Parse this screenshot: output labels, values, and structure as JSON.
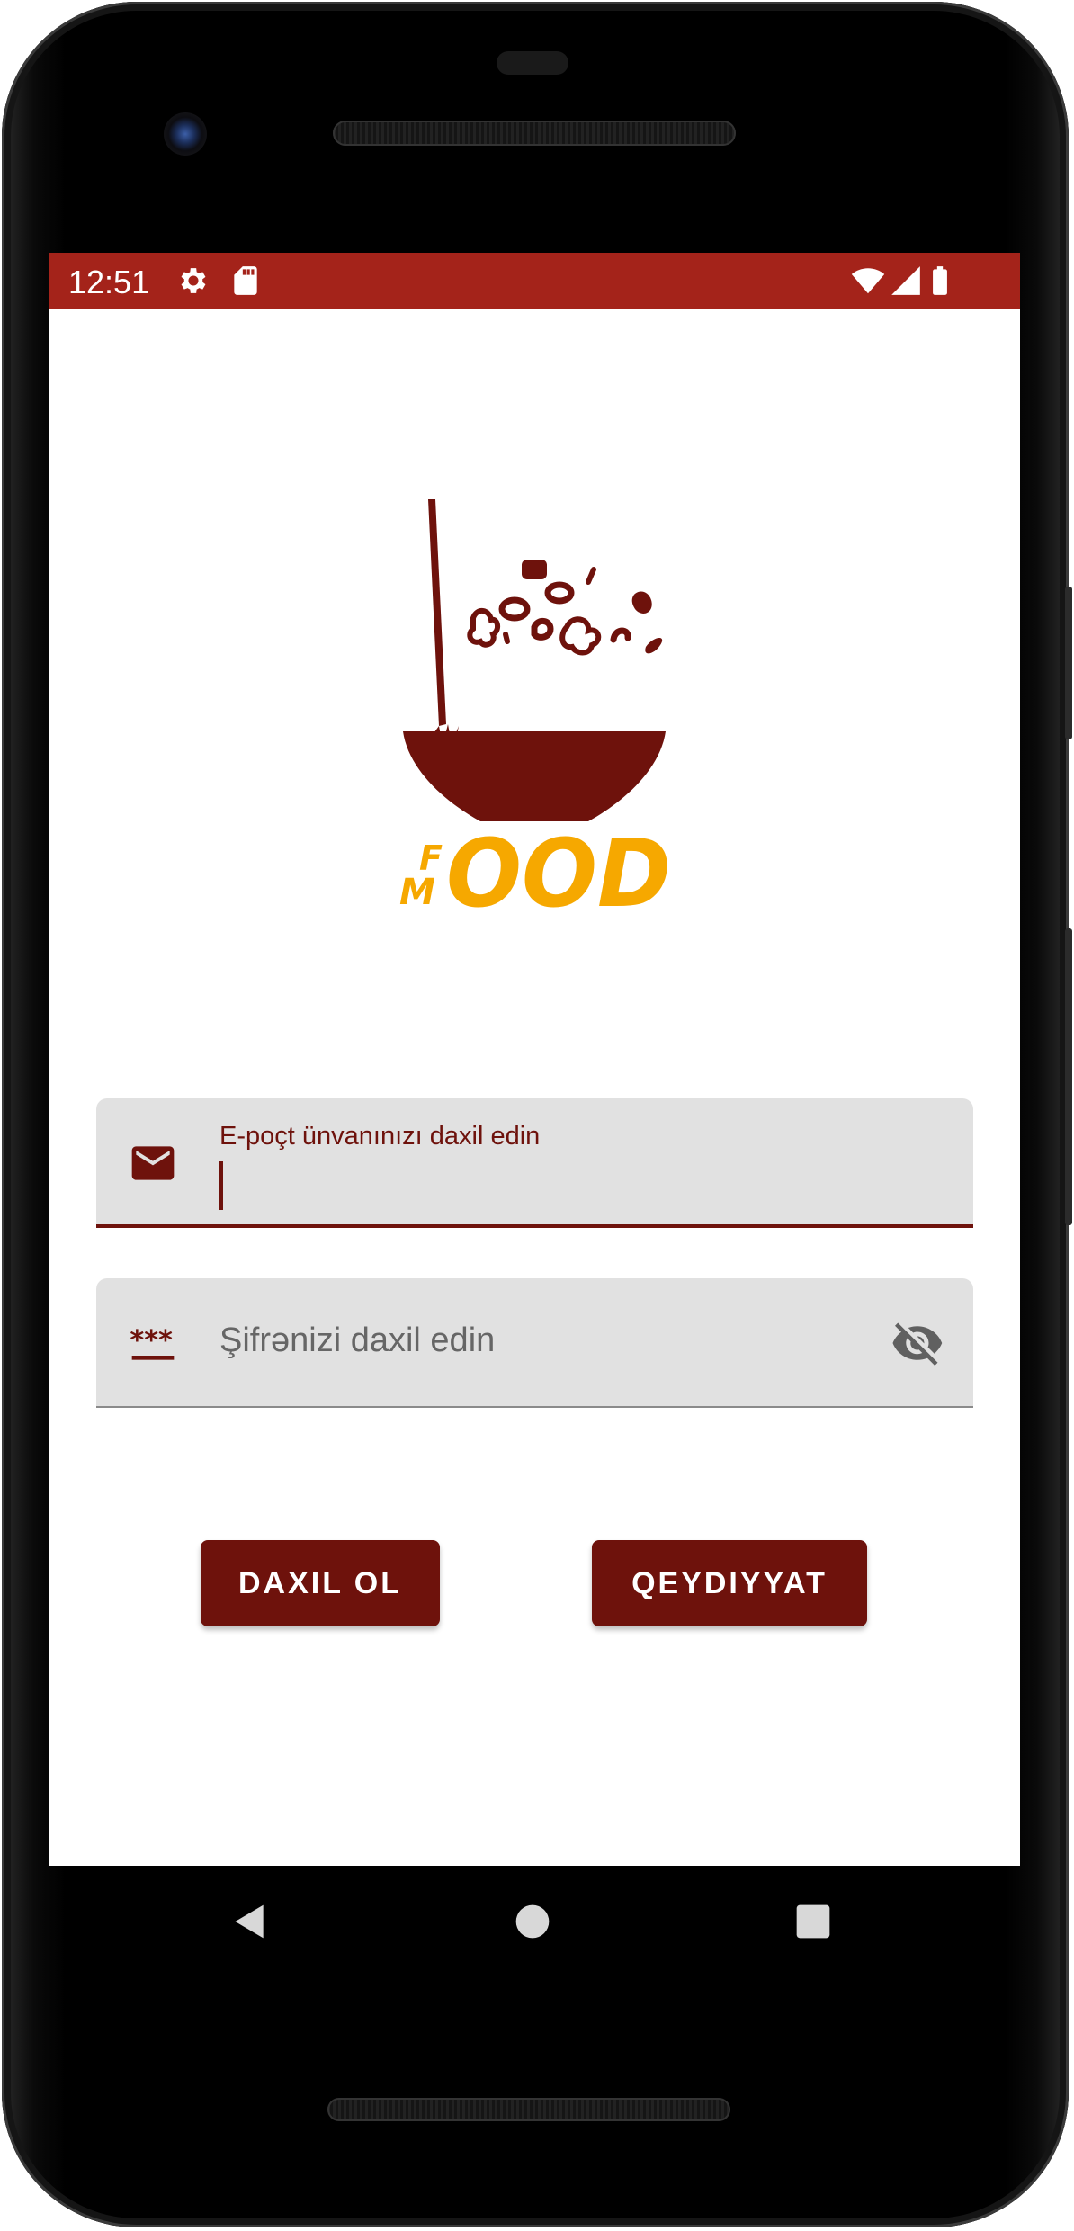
{
  "status_bar": {
    "time": "12:51",
    "background_color": "#a4231a",
    "left_icons": [
      "gear-icon",
      "sd-card-icon"
    ],
    "right_icons": [
      "wifi-icon",
      "signal-icon",
      "battery-icon"
    ]
  },
  "logo": {
    "text_letters": [
      "F",
      "M",
      "OOD"
    ],
    "bowl_color": "#6e120c",
    "text_color": "#f6a800"
  },
  "email_field": {
    "label": "E-poçt ünvanınızı daxil edin",
    "value": "",
    "icon": "mail-icon",
    "focused": true
  },
  "password_field": {
    "placeholder": "Şifrənizi daxil edin",
    "value": "",
    "icon": "password-icon",
    "toggle_icon": "visibility-off-icon"
  },
  "buttons": {
    "login_label": "DAXIL OL",
    "register_label": "QEYDIYYAT"
  },
  "colors": {
    "primary": "#6e120c",
    "status_bar": "#a4231a",
    "field_background": "#e1e1e1",
    "accent_logo": "#f6a800"
  },
  "nav_bar": {
    "icons": [
      "back-icon",
      "home-icon",
      "recents-icon"
    ]
  }
}
